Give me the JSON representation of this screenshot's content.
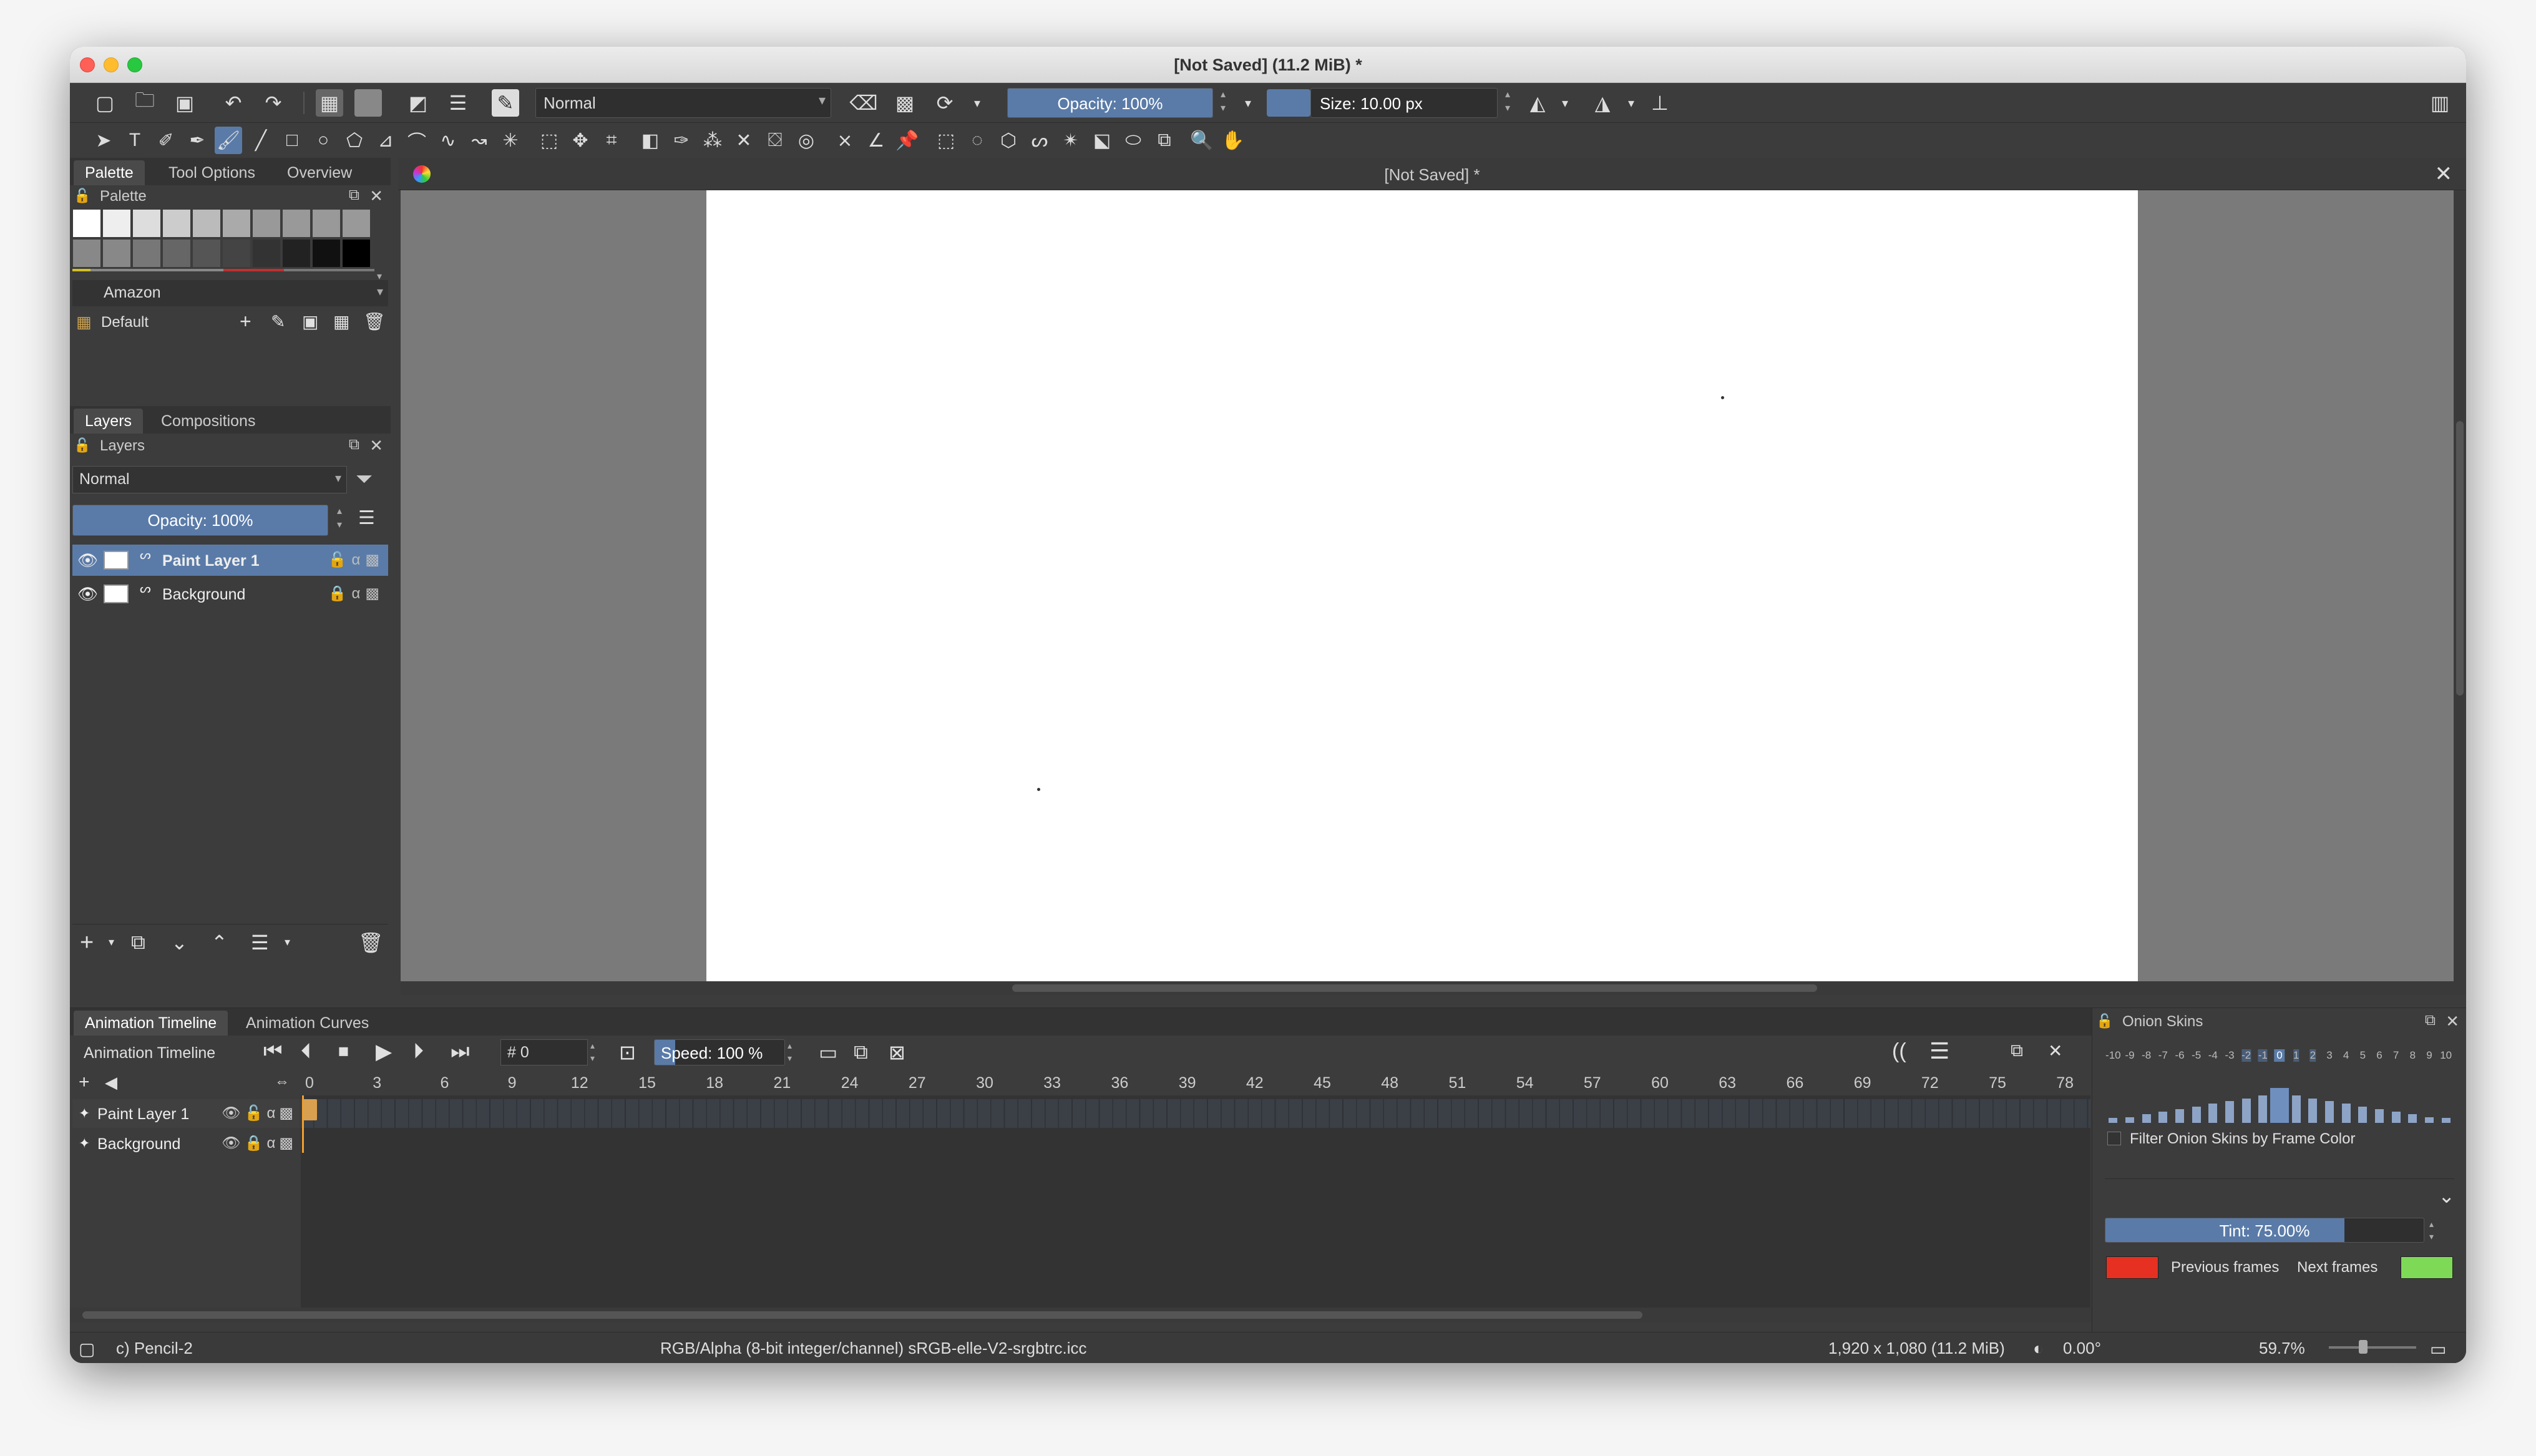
{
  "window": {
    "title": "[Not Saved]  (11.2 MiB)  *"
  },
  "toolbar": {
    "blend_mode": "Normal",
    "opacity_label": "Opacity: 100%",
    "opacity_value": 100,
    "size_label": "Size: 10.00 px"
  },
  "palette_docker": {
    "tabs": [
      "Palette",
      "Tool Options",
      "Overview"
    ],
    "title": "Palette",
    "swatches_row1": [
      "#ffffff",
      "#eeeeee",
      "#dddddd",
      "#cccccc",
      "#bbbbbb",
      "#aaaaaa",
      "#999999",
      "#999999",
      "#999999",
      "#999999"
    ],
    "swatches_row2": [
      "#888888",
      "#888888",
      "#777777",
      "#666666",
      "#555555",
      "#444444",
      "#333333",
      "#222222",
      "#111111",
      "#000000"
    ],
    "palette_name": "Amazon",
    "palette_set": "Default"
  },
  "layers_docker": {
    "tabs": [
      "Layers",
      "Compositions"
    ],
    "title": "Layers",
    "blend_mode": "Normal",
    "opacity_label": "Opacity:  100%",
    "layers": [
      {
        "name": "Paint Layer 1",
        "selected": true
      },
      {
        "name": "Background",
        "selected": false
      }
    ]
  },
  "document": {
    "tab_title": "[Not Saved]  *"
  },
  "timeline": {
    "tabs": [
      "Animation Timeline",
      "Animation Curves"
    ],
    "title": "Animation Timeline",
    "frame_field": "# 0",
    "speed_label": "Speed: 100 %",
    "frame_ticks": [
      "0",
      "3",
      "6",
      "9",
      "12",
      "15",
      "18",
      "21",
      "24",
      "27",
      "30",
      "33",
      "36",
      "39",
      "42",
      "45",
      "48",
      "51",
      "54",
      "57",
      "60",
      "63",
      "66",
      "69",
      "72",
      "75",
      "78"
    ],
    "tracks": [
      "Paint Layer 1",
      "Background"
    ]
  },
  "onion_skins": {
    "title": "Onion Skins",
    "numbers": [
      "-10",
      "-9",
      "-8",
      "-7",
      "-6",
      "-5",
      "-4",
      "-3",
      "-2",
      "-1",
      "0",
      "1",
      "2",
      "3",
      "4",
      "5",
      "6",
      "7",
      "8",
      "9",
      "10"
    ],
    "filter_label": "Filter Onion Skins by Frame Color",
    "tint_label": "Tint: 75.00%",
    "tint_value": 75,
    "previous_label": "Previous frames",
    "next_label": "Next frames",
    "previous_color": "#e53022",
    "next_color": "#7ed957"
  },
  "statusbar": {
    "tool": "c) Pencil-2",
    "color_info": "RGB/Alpha (8-bit integer/channel)  sRGB-elle-V2-srgbtrc.icc",
    "dimensions": "1,920 x 1,080 (11.2 MiB)",
    "rotation": "0.00°",
    "zoom": "59.7%"
  },
  "colors": {
    "accent": "#5a7ba8",
    "background": "#3c3c3c",
    "keyframe": "#d9a050"
  }
}
